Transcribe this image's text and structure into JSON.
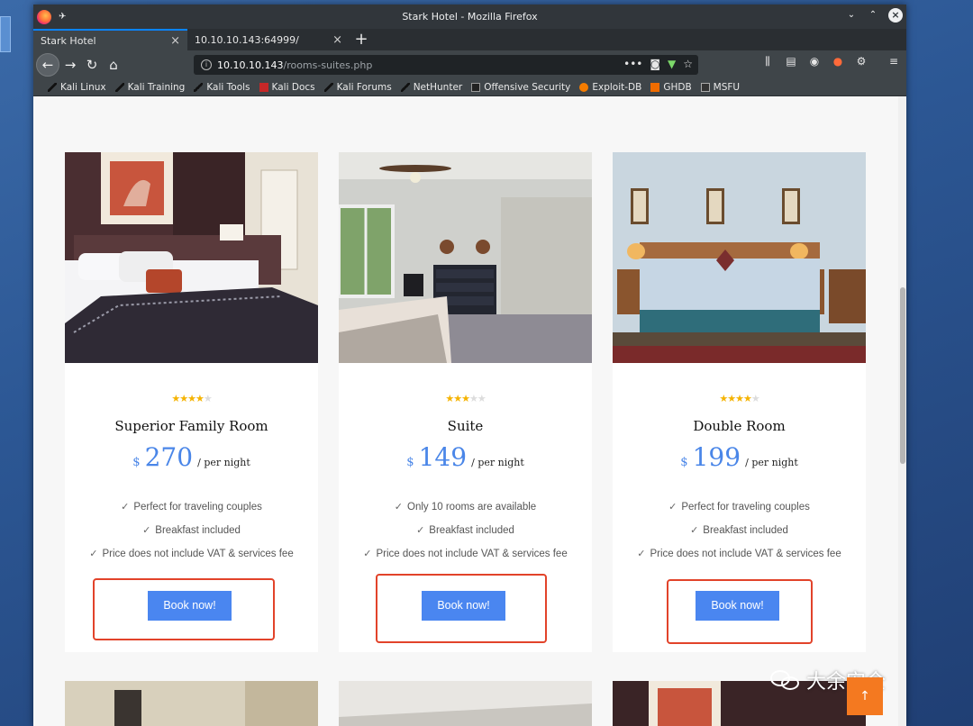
{
  "browser": {
    "window_title": "Stark Hotel - Mozilla Firefox",
    "tabs": [
      {
        "label": "Stark Hotel",
        "active": true
      },
      {
        "label": "10.10.10.143:64999/",
        "active": false
      }
    ],
    "url_host": "10.10.10.143",
    "url_path": "/rooms-suites.php",
    "bookmarks": [
      {
        "label": "Kali Linux",
        "icon": "kali-dragon-icon"
      },
      {
        "label": "Kali Training",
        "icon": "kali-dragon-icon"
      },
      {
        "label": "Kali Tools",
        "icon": "kali-dragon-icon"
      },
      {
        "label": "Kali Docs",
        "icon": "kali-docs-icon"
      },
      {
        "label": "Kali Forums",
        "icon": "kali-dragon-icon"
      },
      {
        "label": "NetHunter",
        "icon": "nethunter-icon"
      },
      {
        "label": "Offensive Security",
        "icon": "offsec-icon"
      },
      {
        "label": "Exploit-DB",
        "icon": "exploitdb-icon"
      },
      {
        "label": "GHDB",
        "icon": "ghdb-icon"
      },
      {
        "label": "MSFU",
        "icon": "msfu-icon"
      }
    ]
  },
  "rooms": [
    {
      "name": "Superior Family Room",
      "stars": 4,
      "currency": "$",
      "price": "270",
      "per": "/ per night",
      "features": [
        "Perfect for traveling couples",
        "Breakfast included",
        "Price does not include VAT & services fee"
      ],
      "button": "Book now!"
    },
    {
      "name": "Suite",
      "stars": 3,
      "currency": "$",
      "price": "149",
      "per": "/ per night",
      "features": [
        "Only 10 rooms are available",
        "Breakfast included",
        "Price does not include VAT & services fee"
      ],
      "button": "Book now!"
    },
    {
      "name": "Double Room",
      "stars": 4,
      "currency": "$",
      "price": "199",
      "per": "/ per night",
      "features": [
        "Perfect for traveling couples",
        "Breakfast included",
        "Price does not include VAT & services fee"
      ],
      "button": "Book now!"
    }
  ],
  "overlay": {
    "wechat_label": "大余安全",
    "to_top": "↑"
  },
  "colors": {
    "accent": "#4a86f0",
    "highlight": "#e2432a",
    "star": "#f5b301",
    "totop": "#f47920"
  }
}
